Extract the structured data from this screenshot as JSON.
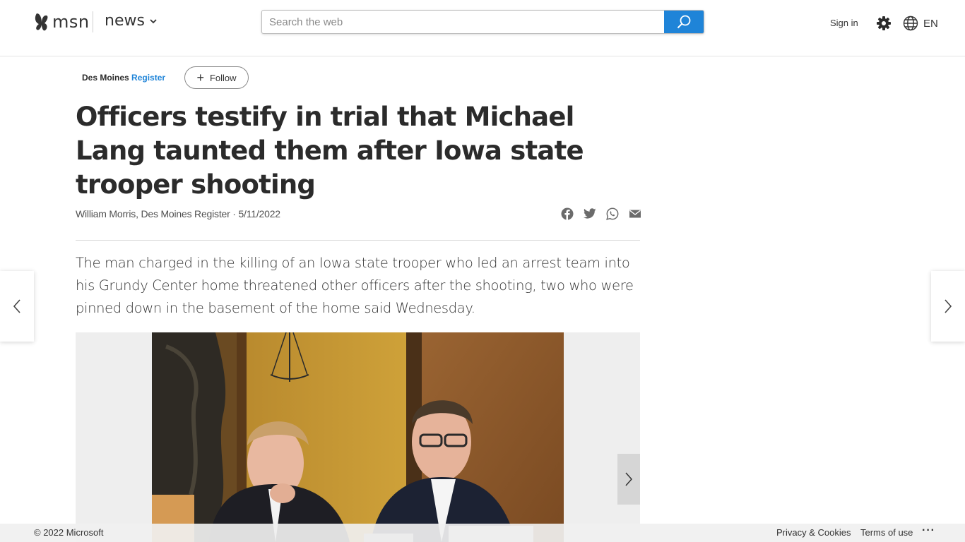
{
  "header": {
    "brand": "msn",
    "section": "news",
    "search": {
      "placeholder": "Search the web"
    },
    "signin_label": "Sign in",
    "language": "EN",
    "accent": "#1f84d8"
  },
  "article": {
    "provider": {
      "name_part1": "Des Moines",
      "name_part2": "Register"
    },
    "follow_label": "Follow",
    "headline": "Officers testify in trial that Michael Lang taunted them after Iowa state trooper shooting",
    "author": "William Morris, Des Moines Register",
    "byline_separator": " · ",
    "date": "5/11/2022",
    "share_icons": [
      "facebook-icon",
      "twitter-icon",
      "whatsapp-icon",
      "email-icon"
    ],
    "lead": "The man charged in the killing of an Iowa state trooper who led an arrest team into his Grundy Center home threatened other officers after the shooting, two who were pinned down in the basement of the home said Wednesday."
  },
  "footer": {
    "copyright": "© 2022 Microsoft",
    "links": [
      "Privacy & Cookies",
      "Terms of use"
    ],
    "more": "···"
  }
}
